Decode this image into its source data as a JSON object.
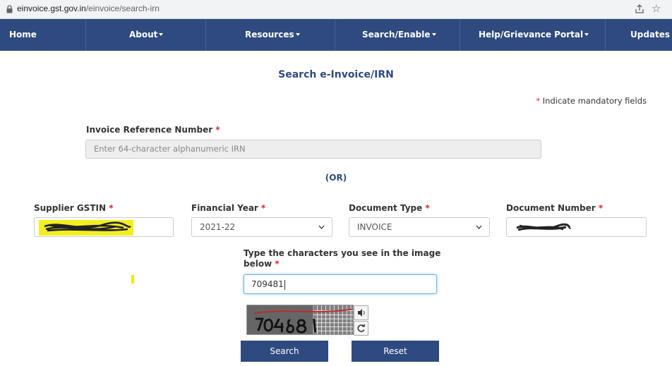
{
  "browser": {
    "url_host": "einvoice.gst.gov.in",
    "url_path": "/einvoice/search-irn"
  },
  "nav": {
    "items": [
      {
        "label": "Home",
        "has_caret": false
      },
      {
        "label": "About",
        "has_caret": true
      },
      {
        "label": "Resources",
        "has_caret": true
      },
      {
        "label": "Search/Enable",
        "has_caret": true
      },
      {
        "label": "Help/Grievance Portal",
        "has_caret": true
      },
      {
        "label": "Updates",
        "has_caret": false
      }
    ]
  },
  "page": {
    "title": "Search e-Invoice/IRN",
    "mandatory_star": "*",
    "mandatory_note": "Indicate mandatory fields",
    "or_text": "(OR)"
  },
  "irn": {
    "label": "Invoice Reference Number",
    "placeholder": "Enter 64-character alphanumeric IRN"
  },
  "fields": {
    "supplier_gstin": {
      "label": "Supplier GSTIN"
    },
    "financial_year": {
      "label": "Financial Year",
      "value": "2021-22"
    },
    "document_type": {
      "label": "Document Type",
      "value": "INVOICE"
    },
    "document_number": {
      "label": "Document Number"
    }
  },
  "captcha": {
    "label_line1": "Type the characters you see in the image",
    "label_line2": "below",
    "value": "709481",
    "image_icon": "captcha-image",
    "audio_icon": "speaker-icon",
    "refresh_icon": "refresh-icon"
  },
  "buttons": {
    "search": "Search",
    "reset": "Reset"
  },
  "colors": {
    "nav_bg": "#2f4a7f",
    "accent": "#2f4a7f",
    "required": "#d9232d",
    "highlight": "#f5e600"
  }
}
